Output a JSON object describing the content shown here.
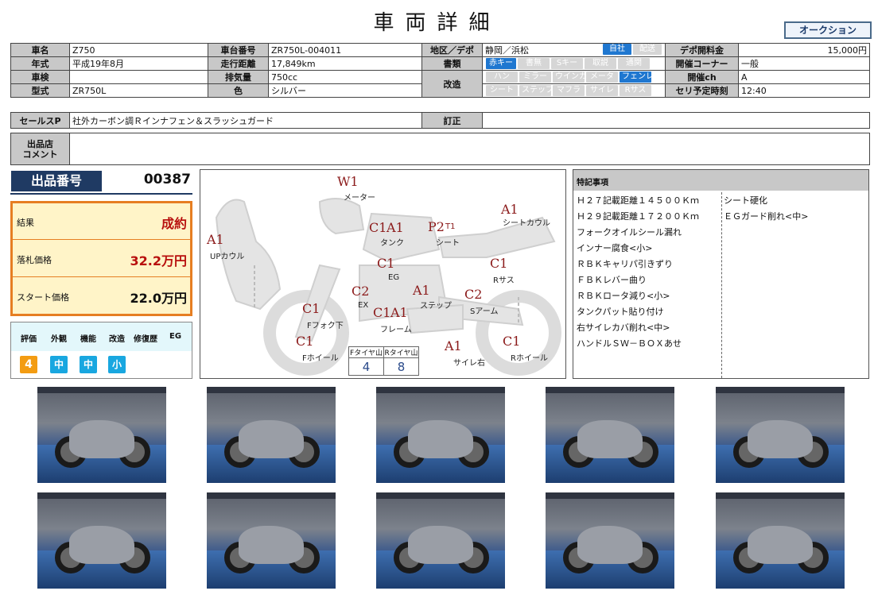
{
  "page": {
    "title": "車両詳細",
    "auction_tag": "オークション"
  },
  "spec": {
    "row1": {
      "k1": "車名",
      "v1": "Z750",
      "k2": "車台番号",
      "v2": "ZR750L-004011",
      "k3": "地区／デポ",
      "v3": "静岡／浜松",
      "chip_a": "自社",
      "chip_b": "配送",
      "k4": "デポ開料金",
      "v4": "15,000円"
    },
    "row2": {
      "k1": "年式",
      "v1": "平成19年8月",
      "k2": "走行距離",
      "v2": "17,849km",
      "k3": "書類",
      "chips": [
        "赤キー",
        "書無",
        "Sキー",
        "取説",
        "通関"
      ],
      "k4": "開催コーナー",
      "v4": "一般"
    },
    "row3": {
      "k1": "車検",
      "v1": "",
      "k2": "排気量",
      "v2": "750cc",
      "k3": "改造",
      "chips": [
        "ハン",
        "ミラー",
        "ウインカ",
        "メータ",
        "フェンレス"
      ],
      "k4": "開催ch",
      "v4": "A"
    },
    "row4": {
      "k1": "型式",
      "v1": "ZR750L",
      "k2": "色",
      "v2": "シルバー",
      "chips": [
        "シート",
        "ステップ",
        "マフラ",
        "サイレ",
        "Rサス"
      ],
      "k4": "セリ予定時刻",
      "v4": "12:40"
    },
    "sales": {
      "k": "セールスP",
      "v": "社外カーボン調Ｒインナフェン＆スラッシュガード",
      "k2": "訂正",
      "v2": ""
    },
    "comment": {
      "k": "出品店\nコメント",
      "v": ""
    }
  },
  "lot": {
    "label": "出品番号",
    "number": "00387"
  },
  "result": {
    "rows": [
      {
        "k": "結果",
        "v": "成約"
      },
      {
        "k": "落札価格",
        "v": "32.2万円"
      },
      {
        "k": "スタート価格",
        "v": "22.0万円"
      }
    ]
  },
  "evaluation": {
    "headers": [
      "評価",
      "外観",
      "機能",
      "改造",
      "修復歴",
      "EG"
    ],
    "values": [
      "4",
      "中",
      "中",
      "小"
    ]
  },
  "diagram": {
    "marks": [
      {
        "code": "W1",
        "label": "メーター"
      },
      {
        "code": "C1",
        "label": ""
      },
      {
        "code": "A1",
        "label": "タンク"
      },
      {
        "code": "P2",
        "sub": "T1",
        "label": "シート"
      },
      {
        "code": "A1",
        "label": "シートカウル"
      },
      {
        "code": "A1",
        "label": "UPカウル"
      },
      {
        "code": "C1",
        "label": "EG"
      },
      {
        "code": "C1",
        "label": "Rサス"
      },
      {
        "code": "C2",
        "label": "EX"
      },
      {
        "code": "A1",
        "label": "ステップ"
      },
      {
        "code": "C2",
        "label": "Sアーム"
      },
      {
        "code": "C1",
        "label": "Fフォク下"
      },
      {
        "code": "C1",
        "label": ""
      },
      {
        "code": "A1",
        "label": "フレーム"
      },
      {
        "code": "C1",
        "label": "Fホイール"
      },
      {
        "code": "A1",
        "label": "サイレ右"
      },
      {
        "code": "C1",
        "label": "Rホイール"
      }
    ],
    "tire": {
      "f_label": "Fタイヤ山",
      "r_label": "Rタイヤ山",
      "f_value": "4",
      "r_value": "8"
    }
  },
  "notes": {
    "title": "特記事項",
    "left": [
      "Ｈ２７記載距離１４５００Ｋｍ",
      "Ｈ２９記載距離１７２００Ｋｍ",
      "フォークオイルシール漏れ",
      "インナー腐食<小>",
      "ＲＢＫキャリパ引きずり",
      "ＦＢＫレバー曲り",
      "ＲＢＫロータ減り<小>",
      "タンクパット貼り付け",
      "右サイレカバ削れ<中>",
      "ハンドルＳＷ－ＢＯＸあせ"
    ],
    "right": [
      "シート硬化",
      "ＥＧガード削れ<中>"
    ]
  },
  "photos": {
    "icon": "motorcycle-photo",
    "count": 10
  }
}
